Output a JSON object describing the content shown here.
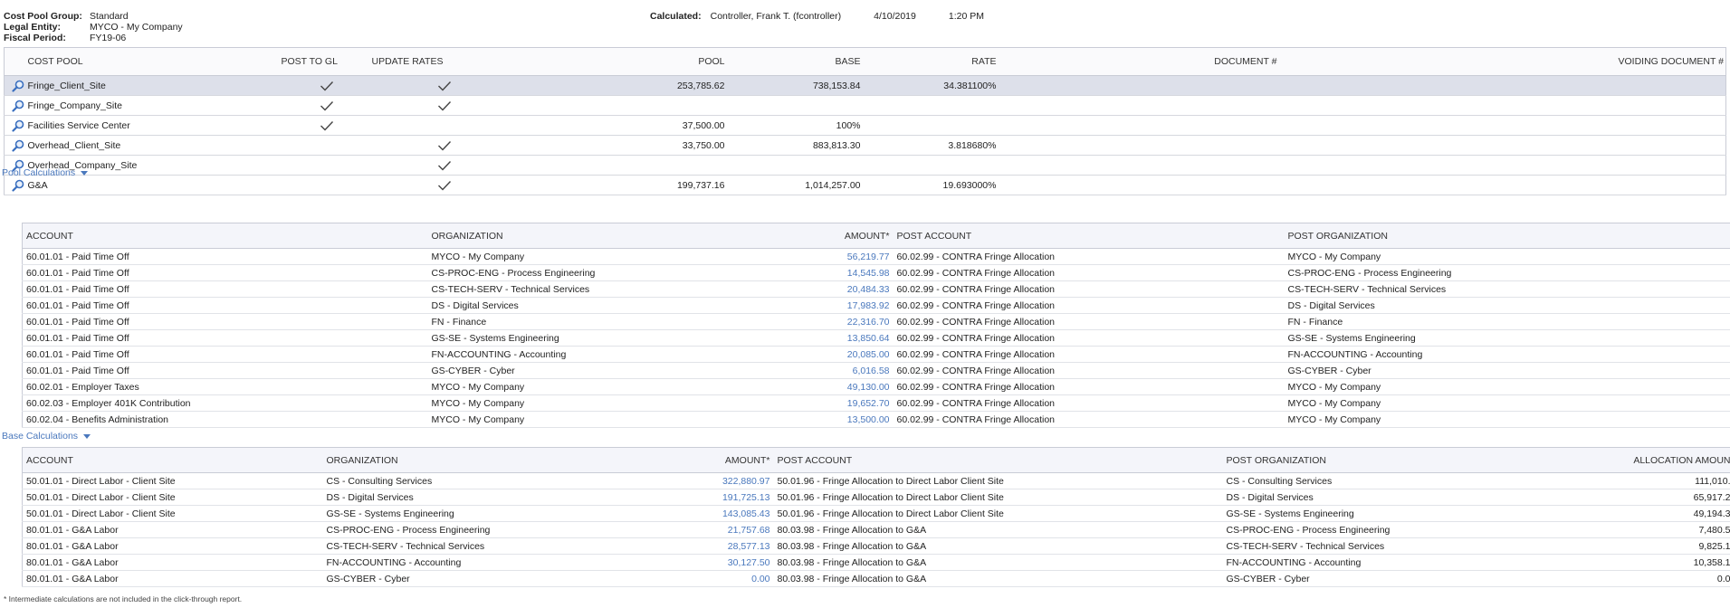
{
  "header": {
    "cost_pool_group_label": "Cost Pool Group:",
    "cost_pool_group_value": "Standard",
    "legal_entity_label": "Legal Entity:",
    "legal_entity_value": "MYCO - My Company",
    "fiscal_period_label": "Fiscal Period:",
    "fiscal_period_value": "FY19-06",
    "calculated_label": "Calculated:",
    "calculated_by": "Controller, Frank T. (fcontroller)",
    "calculated_date": "4/10/2019",
    "calculated_time": "1:20 PM"
  },
  "cost_pool_table": {
    "columns": [
      "COST POOL",
      "POST TO GL",
      "UPDATE RATES",
      "POOL",
      "BASE",
      "RATE",
      "DOCUMENT #",
      "VOIDING DOCUMENT #"
    ],
    "rows": [
      {
        "name": "Fringe_Client_Site",
        "post_to_gl": true,
        "update_rates": true,
        "pool": "253,785.62",
        "base": "738,153.84",
        "rate": "34.381100%"
      },
      {
        "name": "Fringe_Company_Site",
        "post_to_gl": true,
        "update_rates": true,
        "pool": "",
        "base": "",
        "rate": ""
      },
      {
        "name": "Facilities Service Center",
        "post_to_gl": true,
        "update_rates": false,
        "pool": "37,500.00",
        "base": "100%",
        "rate": ""
      },
      {
        "name": "Overhead_Client_Site",
        "post_to_gl": false,
        "update_rates": true,
        "pool": "33,750.00",
        "base": "883,813.30",
        "rate": "3.818680%"
      },
      {
        "name": "Overhead_Company_Site",
        "post_to_gl": false,
        "update_rates": true,
        "pool": "",
        "base": "",
        "rate": ""
      },
      {
        "name": "G&A",
        "post_to_gl": false,
        "update_rates": true,
        "pool": "199,737.16",
        "base": "1,014,257.00",
        "rate": "19.693000%"
      }
    ]
  },
  "pool_calculations": {
    "title": "Pool Calculations",
    "columns": [
      "ACCOUNT",
      "ORGANIZATION",
      "AMOUNT*",
      "POST ACCOUNT",
      "POST ORGANIZATION"
    ],
    "rows": [
      [
        "60.01.01 - Paid Time Off",
        "MYCO - My Company",
        "56,219.77",
        "60.02.99 - CONTRA Fringe Allocation",
        "MYCO - My Company"
      ],
      [
        "60.01.01 - Paid Time Off",
        "CS-PROC-ENG - Process Engineering",
        "14,545.98",
        "60.02.99 - CONTRA Fringe Allocation",
        "CS-PROC-ENG - Process Engineering"
      ],
      [
        "60.01.01 - Paid Time Off",
        "CS-TECH-SERV - Technical Services",
        "20,484.33",
        "60.02.99 - CONTRA Fringe Allocation",
        "CS-TECH-SERV - Technical Services"
      ],
      [
        "60.01.01 - Paid Time Off",
        "DS - Digital Services",
        "17,983.92",
        "60.02.99 - CONTRA Fringe Allocation",
        "DS - Digital Services"
      ],
      [
        "60.01.01 - Paid Time Off",
        "FN - Finance",
        "22,316.70",
        "60.02.99 - CONTRA Fringe Allocation",
        "FN - Finance"
      ],
      [
        "60.01.01 - Paid Time Off",
        "GS-SE - Systems Engineering",
        "13,850.64",
        "60.02.99 - CONTRA Fringe Allocation",
        "GS-SE - Systems Engineering"
      ],
      [
        "60.01.01 - Paid Time Off",
        "FN-ACCOUNTING - Accounting",
        "20,085.00",
        "60.02.99 - CONTRA Fringe Allocation",
        "FN-ACCOUNTING - Accounting"
      ],
      [
        "60.01.01 - Paid Time Off",
        "GS-CYBER - Cyber",
        "6,016.58",
        "60.02.99 - CONTRA Fringe Allocation",
        "GS-CYBER - Cyber"
      ],
      [
        "60.02.01 - Employer Taxes",
        "MYCO - My Company",
        "49,130.00",
        "60.02.99 - CONTRA Fringe Allocation",
        "MYCO - My Company"
      ],
      [
        "60.02.03 - Employer 401K Contribution",
        "MYCO - My Company",
        "19,652.70",
        "60.02.99 - CONTRA Fringe Allocation",
        "MYCO - My Company"
      ],
      [
        "60.02.04 - Benefits Administration",
        "MYCO - My Company",
        "13,500.00",
        "60.02.99 - CONTRA Fringe Allocation",
        "MYCO - My Company"
      ]
    ]
  },
  "base_calculations": {
    "title": "Base Calculations",
    "columns": [
      "ACCOUNT",
      "ORGANIZATION",
      "AMOUNT*",
      "POST ACCOUNT",
      "POST ORGANIZATION",
      "ALLOCATION AMOUN"
    ],
    "rows": [
      [
        "50.01.01 - Direct Labor - Client Site",
        "CS - Consulting Services",
        "322,880.97",
        "50.01.96 - Fringe Allocation to Direct Labor Client Site",
        "CS - Consulting Services",
        "111,010."
      ],
      [
        "50.01.01 - Direct Labor - Client Site",
        "DS - Digital Services",
        "191,725.13",
        "50.01.96 - Fringe Allocation to Direct Labor Client Site",
        "DS - Digital Services",
        "65,917.2"
      ],
      [
        "50.01.01 - Direct Labor - Client Site",
        "GS-SE - Systems Engineering",
        "143,085.43",
        "50.01.96 - Fringe Allocation to Direct Labor Client Site",
        "GS-SE - Systems Engineering",
        "49,194.3"
      ],
      [
        "80.01.01 - G&A Labor",
        "CS-PROC-ENG - Process Engineering",
        "21,757.68",
        "80.03.98 - Fringe Allocation to G&A",
        "CS-PROC-ENG - Process Engineering",
        "7,480.5"
      ],
      [
        "80.01.01 - G&A Labor",
        "CS-TECH-SERV - Technical Services",
        "28,577.13",
        "80.03.98 - Fringe Allocation to G&A",
        "CS-TECH-SERV - Technical Services",
        "9,825.1"
      ],
      [
        "80.01.01 - G&A Labor",
        "FN-ACCOUNTING - Accounting",
        "30,127.50",
        "80.03.98 - Fringe Allocation to G&A",
        "FN-ACCOUNTING - Accounting",
        "10,358.1"
      ],
      [
        "80.01.01 - G&A Labor",
        "GS-CYBER - Cyber",
        "0.00",
        "80.03.98 - Fringe Allocation to G&A",
        "GS-CYBER - Cyber",
        "0.0"
      ]
    ]
  },
  "footnote": "* Intermediate calculations are not included in the click-through report."
}
